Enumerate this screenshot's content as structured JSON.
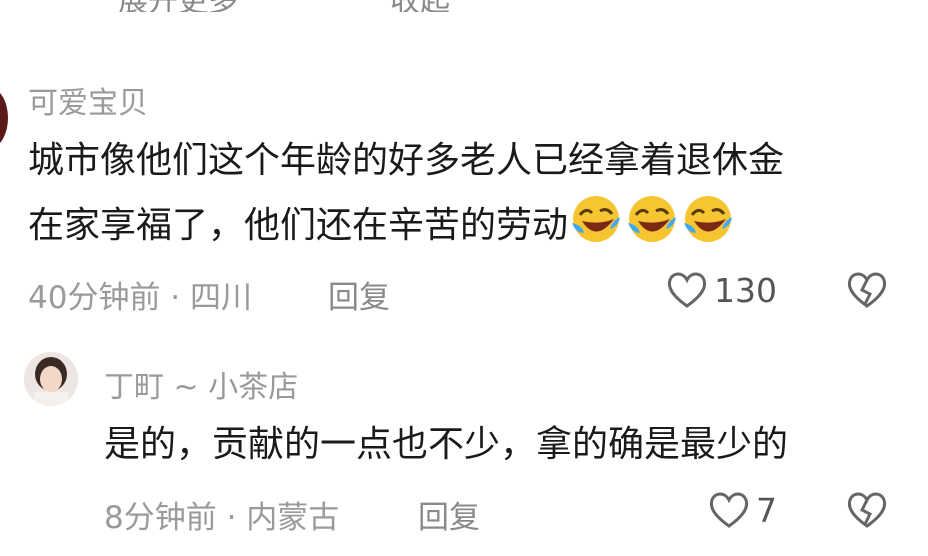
{
  "top_partial": {
    "expand_label": "展开更多",
    "collapse_label": "收起"
  },
  "comments": [
    {
      "username": "可爱宝贝",
      "line1": "城市像他们这个年龄的好多老人已经拿着退休金",
      "line2": "在家享福了，他们还在辛苦的劳动",
      "emoji": [
        "rolling-laughing-emoji",
        "rolling-laughing-emoji",
        "rolling-laughing-emoji"
      ],
      "time": "40分钟前",
      "location": "四川",
      "reply_label": "回复",
      "likes": "130"
    },
    {
      "username": "丁町 ~ 小茶店",
      "line1": "是的，贡献的一点也不少，拿的确是最少的",
      "time": "8分钟前",
      "location": "内蒙古",
      "reply_label": "回复",
      "likes": "7"
    }
  ]
}
